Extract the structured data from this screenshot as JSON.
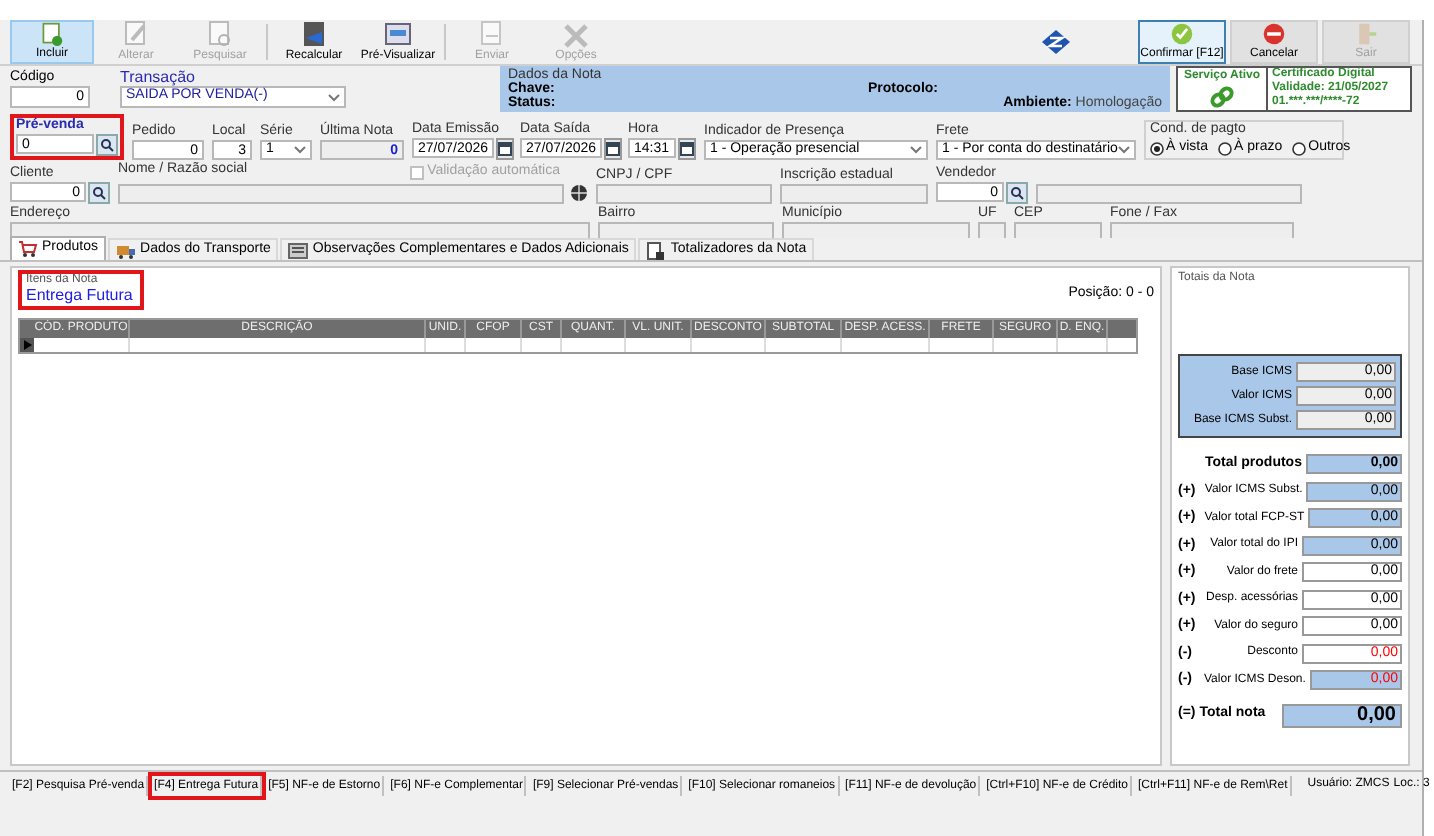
{
  "toolbar": {
    "buttons": [
      {
        "label": "Incluir",
        "disabled": false,
        "selected": true
      },
      {
        "label": "Alterar",
        "disabled": true,
        "selected": false
      },
      {
        "label": "Pesquisar",
        "disabled": true,
        "selected": false
      },
      {
        "label": "Recalcular",
        "disabled": false,
        "selected": false
      },
      {
        "label": "Pré-Visualizar",
        "disabled": false,
        "selected": false
      },
      {
        "label": "Enviar",
        "disabled": true,
        "selected": false
      },
      {
        "label": "Opções",
        "disabled": true,
        "selected": false
      }
    ],
    "actions": [
      {
        "kind": "confirm",
        "label": "Confirmar [F12]",
        "disabled": false,
        "selected": true
      },
      {
        "kind": "cancel",
        "label": "Cancelar",
        "disabled": false,
        "selected": false
      },
      {
        "kind": "exit",
        "label": "Sair",
        "disabled": true,
        "selected": false
      }
    ]
  },
  "header": {
    "codigo": {
      "label": "Código",
      "value": "0"
    },
    "transacao": {
      "label": "Transação",
      "value": "SAIDA POR VENDA(-)"
    },
    "dados_nota": {
      "title": "Dados da Nota",
      "chave": "Chave:",
      "status": "Status:",
      "protocolo": "Protocolo:",
      "ambiente_label": "Ambiente:",
      "ambiente": "Homologação"
    },
    "servico": "Serviço Ativo",
    "certificado": [
      "Certificado Digital",
      "Validade: 21/05/2027",
      "01.***.***/****-72"
    ]
  },
  "rows": [
    [
      {
        "kind": "lookup",
        "label": "Pré-venda",
        "value": "0",
        "annotated": true
      },
      {
        "kind": "input",
        "label": "Pedido",
        "value": "0"
      },
      {
        "kind": "input",
        "label": "Local",
        "value": "3"
      },
      {
        "kind": "select",
        "label": "Série",
        "value": "1"
      },
      {
        "kind": "readonly",
        "label": "Última Nota",
        "value": "0"
      },
      {
        "kind": "date",
        "label": "Data Emissão",
        "value": "27/07/2026"
      },
      {
        "kind": "date",
        "label": "Data Saída",
        "value": "27/07/2026"
      },
      {
        "kind": "date",
        "label": "Hora",
        "value": "14:31"
      },
      {
        "kind": "select",
        "label": "Indicador de Presença",
        "value": "1 - Operação presencial"
      },
      {
        "kind": "select",
        "label": "Frete",
        "value": "1 - Por conta do destinatário"
      },
      {
        "kind": "radios",
        "label": "Cond. de pagto",
        "options": [
          {
            "label": "À vista",
            "selected": true
          },
          {
            "label": "À prazo",
            "selected": false
          },
          {
            "label": "Outros",
            "selected": false
          }
        ]
      }
    ],
    [
      {
        "kind": "lookup",
        "label": "Cliente",
        "value": "0"
      },
      {
        "kind": "name",
        "label": "Nome / Razão social",
        "checkbox": {
          "label": "Validação automática",
          "checked": false,
          "disabled": true
        }
      },
      {
        "kind": "readonly",
        "label": "CNPJ / CPF"
      },
      {
        "kind": "readonly",
        "label": "Inscrição estadual"
      },
      {
        "kind": "lookup",
        "label": "Vendedor",
        "value": "0"
      },
      {
        "kind": "readonly"
      }
    ],
    [
      {
        "kind": "readonly",
        "label": "Endereço"
      },
      {
        "kind": "readonly",
        "label": "Bairro"
      },
      {
        "kind": "readonly",
        "label": "Município"
      },
      {
        "kind": "readonly",
        "label": "UF"
      },
      {
        "kind": "readonly",
        "label": "CEP"
      },
      {
        "kind": "readonly",
        "label": "Fone / Fax"
      }
    ]
  ],
  "tabs": [
    {
      "label": "Produtos",
      "selected": true
    },
    {
      "label": "Dados do Transporte",
      "selected": false
    },
    {
      "label": "Observações Complementares e Dados Adicionais",
      "selected": false
    },
    {
      "label": "Totalizadores da Nota",
      "selected": false
    }
  ],
  "items": {
    "title": "Itens da Nota",
    "link": "Entrega Futura",
    "position": "Posição: 0 - 0",
    "columns": [
      "CÓD. PRODUTO",
      "DESCRIÇÃO",
      "UNID.",
      "CFOP",
      "CST",
      "QUANT.",
      "VL. UNIT.",
      "DESCONTO",
      "SUBTOTAL",
      "DESP. ACESS.",
      "FRETE",
      "SEGURO",
      "D. ENQ."
    ]
  },
  "totals": {
    "title": "Totais da Nota",
    "icms": [
      {
        "label": "Base ICMS",
        "value": "0,00"
      },
      {
        "label": "Valor ICMS",
        "value": "0,00"
      },
      {
        "label": "Base ICMS Subst.",
        "value": "0,00"
      }
    ],
    "lines": [
      {
        "label": "Total produtos",
        "value": "0,00",
        "shaded": true,
        "color": "#000000"
      },
      {
        "sign": "(+)",
        "label": "Valor ICMS Subst.",
        "value": "0,00",
        "shaded": true,
        "color": "#000000"
      },
      {
        "sign": "(+)",
        "label": "Valor total FCP-ST",
        "value": "0,00",
        "shaded": true,
        "color": "#000000"
      },
      {
        "sign": "(+)",
        "label": "Valor total do IPI",
        "value": "0,00",
        "shaded": true,
        "color": "#000000"
      },
      {
        "sign": "(+)",
        "label": "Valor do frete",
        "value": "0,00",
        "shaded": false,
        "color": "#000000"
      },
      {
        "sign": "(+)",
        "label": "Desp. acessórias",
        "value": "0,00",
        "shaded": false,
        "color": "#000000"
      },
      {
        "sign": "(+)",
        "label": "Valor do seguro",
        "value": "0,00",
        "shaded": false,
        "color": "#000000"
      },
      {
        "sign": "(-)",
        "label": "Desconto",
        "value": "0,00",
        "shaded": false,
        "color": "#ff0000"
      },
      {
        "sign": "(-)",
        "label": "Valor ICMS Deson.",
        "value": "0,00",
        "shaded": true,
        "color": "#ff0000"
      }
    ],
    "total": {
      "sign": "(=)",
      "label": "Total nota",
      "value": "0,00"
    }
  },
  "status_bar": {
    "items": [
      {
        "label": "[F2] Pesquisa Pré-venda",
        "annotated": false
      },
      {
        "label": "[F4] Entrega Futura",
        "annotated": true
      },
      {
        "label": "[F5] NF-e de Estorno",
        "annotated": false
      },
      {
        "label": "[F6] NF-e Complementar",
        "annotated": false
      },
      {
        "label": "[F9] Selecionar Pré-vendas",
        "annotated": false
      },
      {
        "label": "[F10] Selecionar romaneios",
        "annotated": false
      },
      {
        "label": "[F11] NF-e de devolução",
        "annotated": false
      },
      {
        "label": "[Ctrl+F10] NF-e de Crédito",
        "annotated": false
      },
      {
        "label": "[Ctrl+F11] NF-e de Rem\\Ret",
        "annotated": false
      }
    ],
    "user": "Usuário: ZMCS",
    "location": "Loc.: 3"
  }
}
